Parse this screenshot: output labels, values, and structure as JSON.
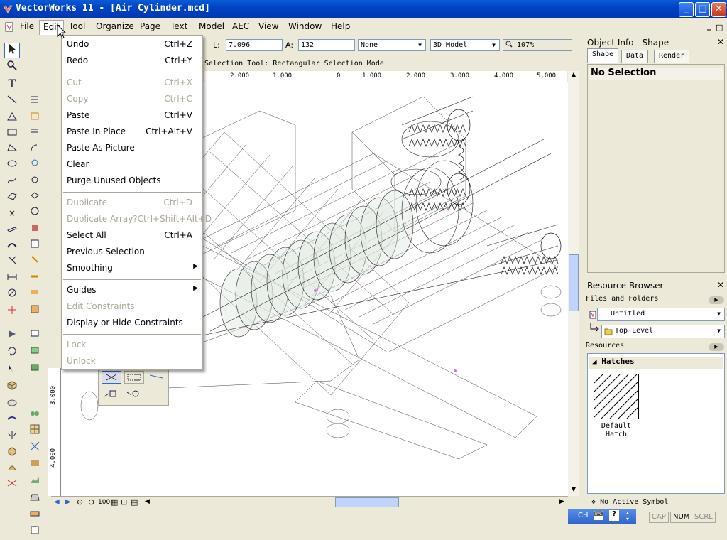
{
  "window": {
    "title": "VectorWorks 11 - [Air Cylinder.mcd]",
    "minimize": "_",
    "maximize": "□",
    "close": "✕"
  },
  "menubar": {
    "items": [
      "File",
      "Edit",
      "Tool",
      "Organize",
      "Page",
      "Text",
      "Model",
      "AEC",
      "View",
      "Window",
      "Help"
    ],
    "active": "Edit"
  },
  "mdi_controls": [
    "_",
    "□",
    "✕"
  ],
  "edit_menu": {
    "groups": [
      [
        {
          "label": "Undo",
          "shortcut": "Ctrl+Z",
          "enabled": true
        },
        {
          "label": "Redo",
          "shortcut": "Ctrl+Y",
          "enabled": true
        }
      ],
      [
        {
          "label": "Cut",
          "shortcut": "Ctrl+X",
          "enabled": false
        },
        {
          "label": "Copy",
          "shortcut": "Ctrl+C",
          "enabled": false
        },
        {
          "label": "Paste",
          "shortcut": "Ctrl+V",
          "enabled": true
        },
        {
          "label": "Paste In Place",
          "shortcut": "Ctrl+Alt+V",
          "enabled": true
        },
        {
          "label": "Paste As Picture",
          "shortcut": "",
          "enabled": true
        },
        {
          "label": "Clear",
          "shortcut": "",
          "enabled": true
        },
        {
          "label": "Purge Unused Objects",
          "shortcut": "",
          "enabled": true
        }
      ],
      [
        {
          "label": "Duplicate",
          "shortcut": "Ctrl+D",
          "enabled": false
        },
        {
          "label": "Duplicate Array?Ctrl+Shift+Alt+D",
          "shortcut": "",
          "enabled": false
        },
        {
          "label": "Select All",
          "shortcut": "Ctrl+A",
          "enabled": true
        },
        {
          "label": "Previous Selection",
          "shortcut": "",
          "enabled": true
        },
        {
          "label": "Smoothing",
          "shortcut": "",
          "enabled": true,
          "submenu": true
        }
      ],
      [
        {
          "label": "Guides",
          "shortcut": "",
          "enabled": true,
          "submenu": true
        },
        {
          "label": "Edit Constraints",
          "shortcut": "",
          "enabled": false
        },
        {
          "label": "Display or Hide Constraints",
          "shortcut": "",
          "enabled": true
        }
      ],
      [
        {
          "label": "Lock",
          "shortcut": "",
          "enabled": false
        },
        {
          "label": "Unlock",
          "shortcut": "",
          "enabled": false
        }
      ]
    ]
  },
  "data_bar": {
    "l_label": "L:",
    "l_value": "7.096",
    "a_label": "A:",
    "a_value": "132",
    "class_select": "None",
    "view_select": "3D Model",
    "zoom": "107%"
  },
  "mode_text": "Selection Tool: Rectangular Selection Mode",
  "ruler_top": [
    "2.000",
    "1.000",
    "0",
    "1.000",
    "2.000",
    "3.000",
    "4.000",
    "5.000"
  ],
  "ruler_left": [
    "3.000",
    "4.000"
  ],
  "object_info": {
    "title": "Object Info - Shape",
    "tabs": [
      "Shape",
      "Data",
      "Render"
    ],
    "active_tab": "Shape",
    "status": "No Selection"
  },
  "resource_browser": {
    "title": "Resource Browser",
    "files_label": "Files and Folders",
    "file_select": "Untitled1",
    "folder_select": "Top Level",
    "resources_label": "Resources",
    "group": "Hatches",
    "item": "Default Hatch",
    "footer": "No Active Symbol"
  },
  "hscroll": {
    "zoom_reset": "100"
  },
  "statusbar": {
    "ime": "CH",
    "cap": "CAP",
    "num": "NUM",
    "scrl": "SCRL",
    "help": "?"
  },
  "icons": [
    "app-logo-icon",
    "arrow-selection-icon",
    "zoom-icon",
    "text-icon",
    "line-icon",
    "triangle-icon",
    "rectangle-icon",
    "polyline-icon",
    "circle-icon",
    "hatch-icon",
    "resource-folder-icon",
    "search-icon"
  ]
}
